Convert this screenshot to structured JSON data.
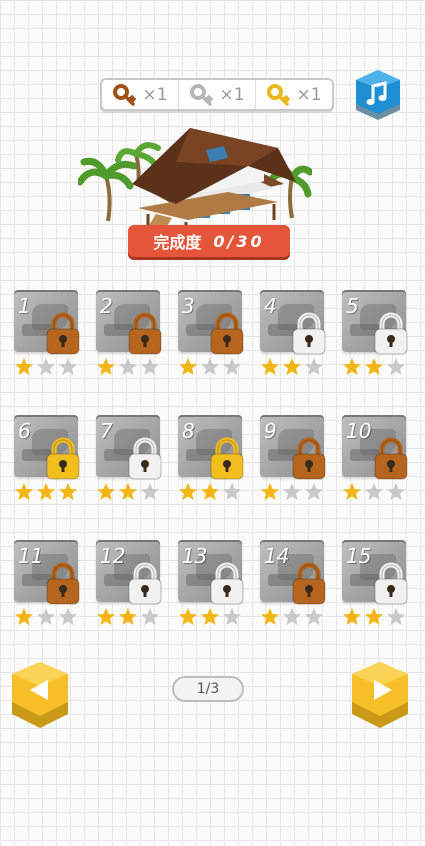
{
  "keys": [
    {
      "type": "bronze",
      "label": "×1",
      "color": "#a1521a"
    },
    {
      "type": "silver",
      "label": "×1",
      "color": "#b7b7b7"
    },
    {
      "type": "gold",
      "label": "×1",
      "color": "#e8b81d"
    }
  ],
  "music_icon": "music-note-icon",
  "completion": {
    "label": "完成度",
    "value": "0/30"
  },
  "levels": [
    {
      "number": "1",
      "lock": "bronze",
      "stars": 1
    },
    {
      "number": "2",
      "lock": "bronze",
      "stars": 1
    },
    {
      "number": "3",
      "lock": "bronze",
      "stars": 1
    },
    {
      "number": "4",
      "lock": "silver",
      "stars": 2
    },
    {
      "number": "5",
      "lock": "silver",
      "stars": 2
    },
    {
      "number": "6",
      "lock": "gold",
      "stars": 3
    },
    {
      "number": "7",
      "lock": "silver",
      "stars": 2
    },
    {
      "number": "8",
      "lock": "gold",
      "stars": 2
    },
    {
      "number": "9",
      "lock": "bronze",
      "stars": 1
    },
    {
      "number": "10",
      "lock": "bronze",
      "stars": 1
    },
    {
      "number": "11",
      "lock": "bronze",
      "stars": 1
    },
    {
      "number": "12",
      "lock": "silver",
      "stars": 2
    },
    {
      "number": "13",
      "lock": "silver",
      "stars": 2
    },
    {
      "number": "14",
      "lock": "bronze",
      "stars": 1
    },
    {
      "number": "15",
      "lock": "silver",
      "stars": 2
    }
  ],
  "lock_colors": {
    "bronze": "#b5651d",
    "silver": "#f1f1f1",
    "gold": "#f2be1e"
  },
  "star_colors": {
    "on": "#f3b616",
    "off": "#c9c9c9"
  },
  "pager": {
    "text": "1/3"
  },
  "nav": {
    "prev_icon": "arrow-left-icon",
    "next_icon": "arrow-right-icon",
    "color": "#f6bf26"
  }
}
